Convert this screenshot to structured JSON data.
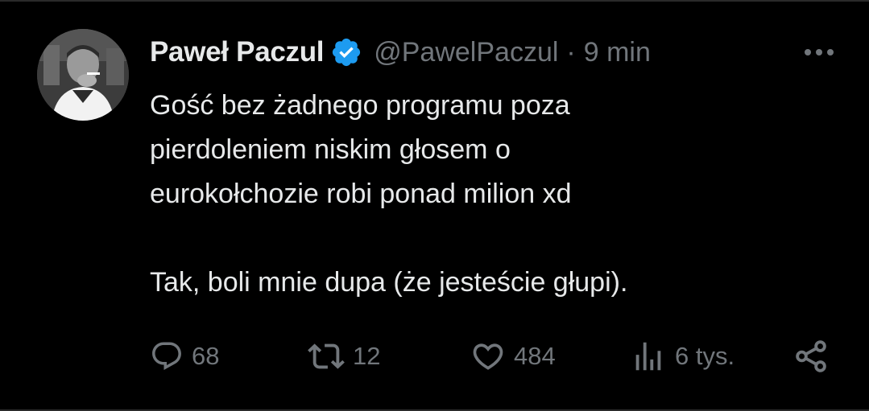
{
  "tweet": {
    "author_name": "Paweł Paczul",
    "handle": "@PawelPaczul",
    "separator": "·",
    "time": "9 min",
    "verified": true,
    "text_lines": [
      "Gość bez żadnego programu poza",
      "pierdoleniem niskim głosem o",
      "eurokołchozie robi ponad milion xd",
      "Tak, boli mnie dupa (że jesteście głupi)."
    ]
  },
  "actions": {
    "replies": "68",
    "reposts": "12",
    "likes": "484",
    "views": "6 tys."
  },
  "icons": {
    "verified": "verified-badge-icon",
    "more": "more-horizontal-icon",
    "reply": "reply-icon",
    "repost": "repost-icon",
    "like": "heart-icon",
    "views": "analytics-icon",
    "share": "share-icon"
  },
  "colors": {
    "background": "#000000",
    "text": "#e7e9ea",
    "muted": "#71767b",
    "verified": "#1d9bf0"
  }
}
